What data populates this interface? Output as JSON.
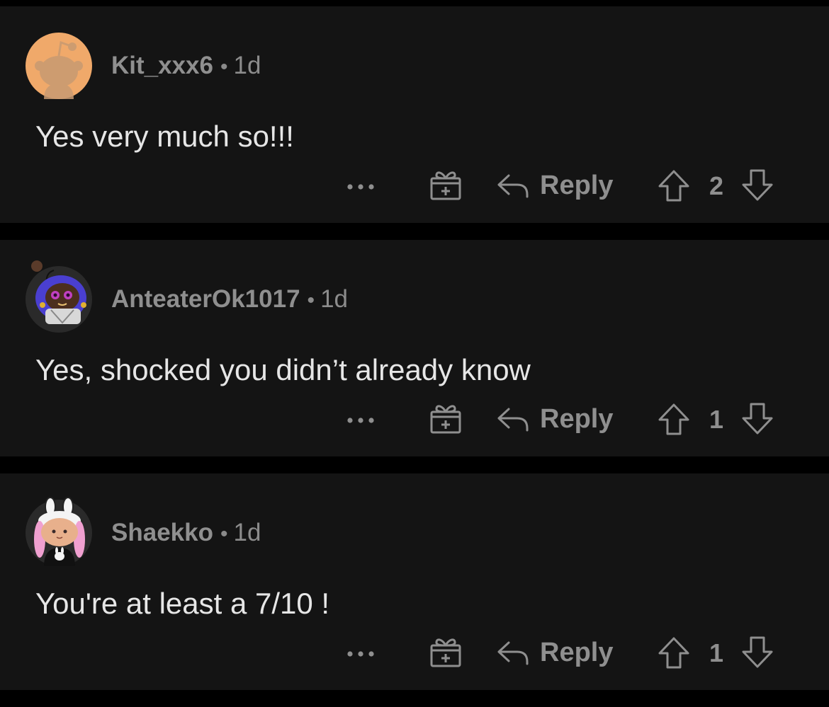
{
  "comments": [
    {
      "username": "Kit_xxx6",
      "separator": "•",
      "age": "1d",
      "text": "Yes very much so!!!",
      "actions": {
        "reply_label": "Reply"
      },
      "score": "2",
      "avatar_icon": "reddit-snoo-avatar-icon",
      "avatar_bg": "#f0a96a"
    },
    {
      "username": "AnteaterOk1017",
      "separator": "•",
      "age": "1d",
      "text": "Yes, shocked you didn’t already know",
      "actions": {
        "reply_label": "Reply"
      },
      "score": "1",
      "avatar_icon": "custom-snoo-avatar-icon",
      "avatar_bg": "#2a2a2a"
    },
    {
      "username": "Shaekko",
      "separator": "•",
      "age": "1d",
      "text": "You're at least a 7/10 !",
      "actions": {
        "reply_label": "Reply"
      },
      "score": "1",
      "avatar_icon": "bunny-snoo-avatar-icon",
      "avatar_bg": "#2a2a2a"
    }
  ],
  "colors": {
    "background": "#000000",
    "card": "#141414",
    "text": "#e6e6e6",
    "muted": "#8f8f8f"
  }
}
